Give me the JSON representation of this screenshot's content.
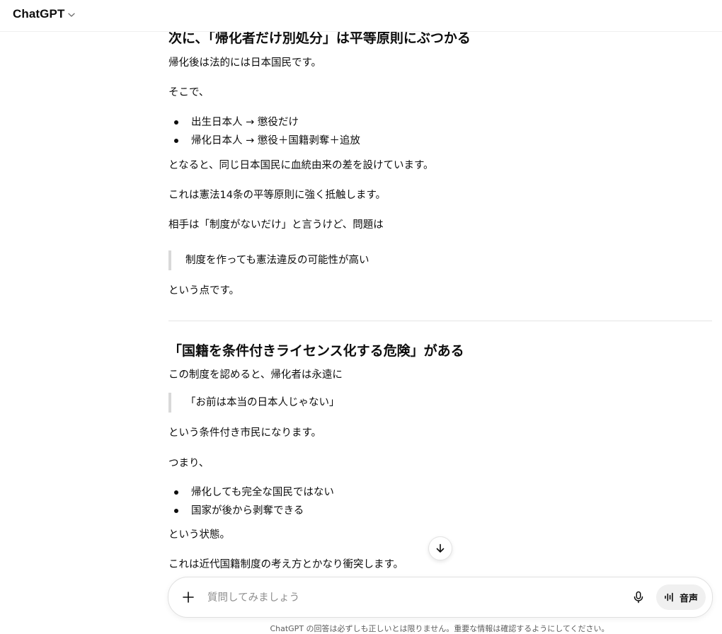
{
  "header": {
    "model_name": "ChatGPT",
    "model_picker_icon": "chevron-down-icon"
  },
  "message": {
    "section1": {
      "heading": "次に、「帰化者だけ別処分」は平等原則にぶつかる",
      "p1": "帰化後は法的には日本国民です。",
      "p2": "そこで、",
      "bullets": [
        "出生日本人 → 懲役だけ",
        "帰化日本人 → 懲役＋国籍剥奪＋追放"
      ],
      "p3": "となると、同じ日本国民に血統由来の差を設けています。",
      "p4": "これは憲法14条の平等原則に強く抵触します。",
      "p5": "相手は「制度がないだけ」と言うけど、問題は",
      "quote": "制度を作っても憲法違反の可能性が高い",
      "p6": "という点です。"
    },
    "section2": {
      "heading": "「国籍を条件付きライセンス化する危険」がある",
      "p1": "この制度を認めると、帰化者は永遠に",
      "quote": "「お前は本当の日本人じゃない」",
      "p2": "という条件付き市民になります。",
      "p3": "つまり、",
      "bullets": [
        "帰化しても完全な国民ではない",
        "国家が後から剥奪できる"
      ],
      "p4": "という状態。",
      "p5": "これは近代国籍制度の考え方とかなり衝突します。"
    }
  },
  "scroll_button": {
    "icon": "arrow-down-icon"
  },
  "composer": {
    "placeholder": "質問してみましょう",
    "add_icon": "plus-icon",
    "mic_icon": "microphone-icon",
    "voice_icon": "voice-waveform-icon",
    "voice_label": "音声"
  },
  "footer": {
    "disclaimer": "ChatGPT の回答は必ずしも正しいとは限りません。重要な情報は確認するようにしてください。"
  },
  "colors": {
    "text": "#0d0d0d",
    "muted": "#5d5d5d",
    "border": "#e0e0e0",
    "quote_bar": "#d9d9d9",
    "voice_bg": "#f0f0f0"
  }
}
